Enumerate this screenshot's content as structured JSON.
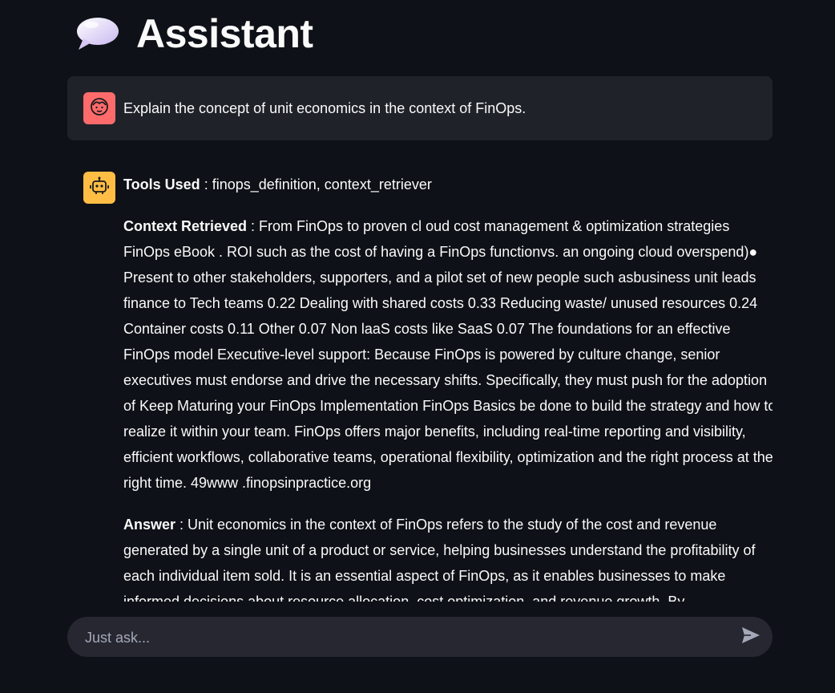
{
  "header": {
    "title": "Assistant",
    "icon": "speech-balloon-icon"
  },
  "messages": {
    "user": {
      "avatar_icon": "user-face-icon",
      "avatar_color": "#ff6b6b",
      "text": "Explain the concept of unit economics in the context of FinOps."
    },
    "assistant": {
      "avatar_icon": "robot-icon",
      "avatar_color": "#ffbd45",
      "tools_label": "Tools Used",
      "tools_value": " : finops_definition, context_retriever",
      "context_label": "Context Retrieved",
      "context_value": " : From FinOps to proven cl oud cost management & optimization strategies FinOps eBook . ROI such as the cost of having a FinOps functionvs. an ongoing cloud overspend)● Present to other stakeholders, supporters, and a pilot set of new people such asbusiness unit leads finance to Tech teams 0.22 Dealing with shared costs 0.33 Reducing waste/ unused resources 0.24 Container costs 0.11 Other 0.07 Non laaS costs like SaaS 0.07 The foundations for an effective FinOps model Executive-level support: Because FinOps is powered by culture change, senior executives must endorse and drive the necessary shifts. Specifically, they must push for the adoption of Keep Maturing your FinOps Implementation FinOps Basics be done to build the strategy and how to realize it within your team. FinOps offers major benefits, including real-time reporting and visibility, efficient workflows, collaborative teams, operational flexibility, optimization and the right process at the right time. 49www .finopsinpractice.org",
      "answer_label": "Answer",
      "answer_value": " : Unit economics in the context of FinOps refers to the study of the cost and revenue generated by a single unit of a product or service, helping businesses understand the profitability of each individual item sold. It is an essential aspect of FinOps, as it enables businesses to make informed decisions about resource allocation, cost optimization, and revenue growth. By"
    }
  },
  "chat_input": {
    "placeholder": "Just ask...",
    "value": "",
    "send_icon": "send-arrow-icon"
  },
  "colors": {
    "background": "#0e1117",
    "user_bubble": "#262730",
    "text": "#fafafa",
    "placeholder": "#a3a8b8"
  }
}
